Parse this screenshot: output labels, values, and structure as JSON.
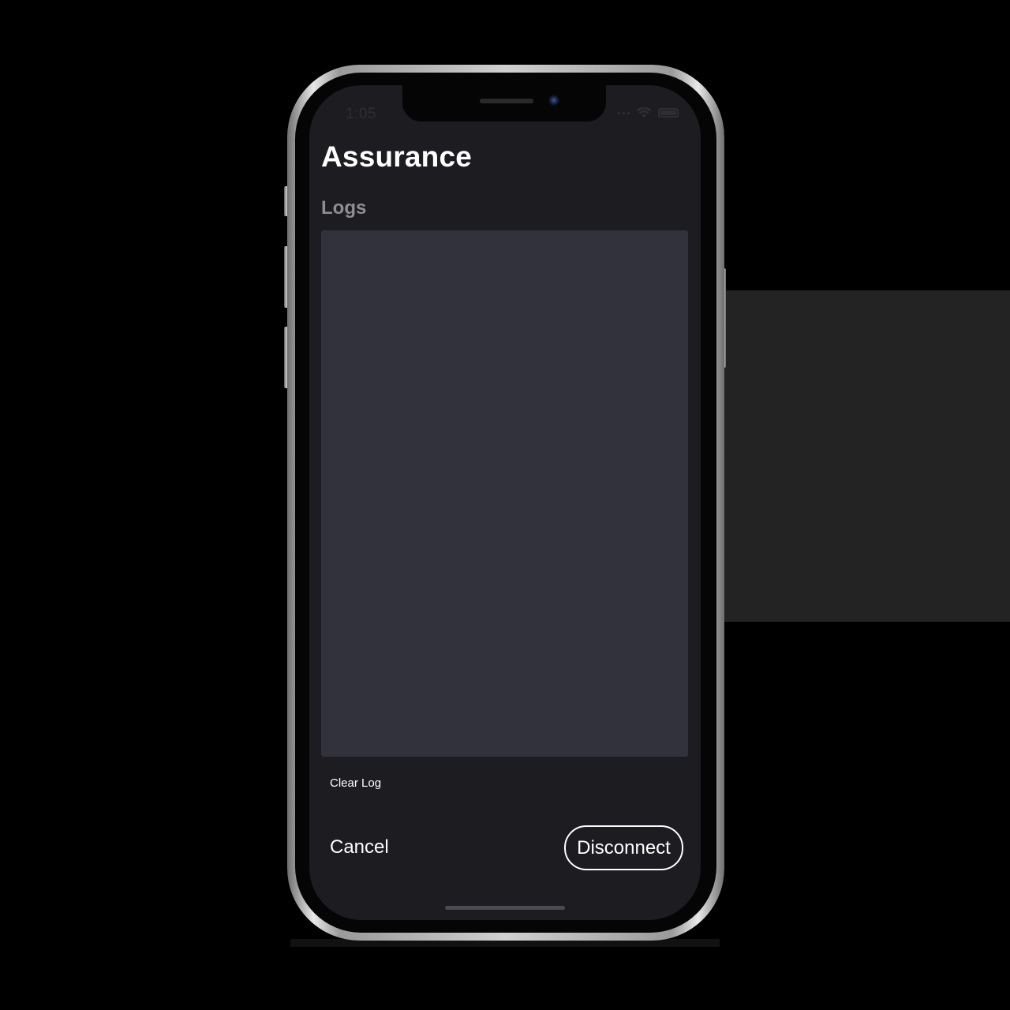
{
  "status_bar": {
    "time": "1:05"
  },
  "screen": {
    "title": "Assurance",
    "logs_label": "Logs",
    "log_content": "",
    "clear_log_label": "Clear Log",
    "cancel_label": "Cancel",
    "disconnect_label": "Disconnect"
  },
  "colors": {
    "screen_background": "#1c1c21",
    "log_area_background": "#32323c",
    "section_label": "#8e8e93",
    "text": "#ffffff"
  },
  "icons": {
    "wifi": "wifi-icon",
    "battery": "battery-icon",
    "signal": "signal-icon"
  }
}
